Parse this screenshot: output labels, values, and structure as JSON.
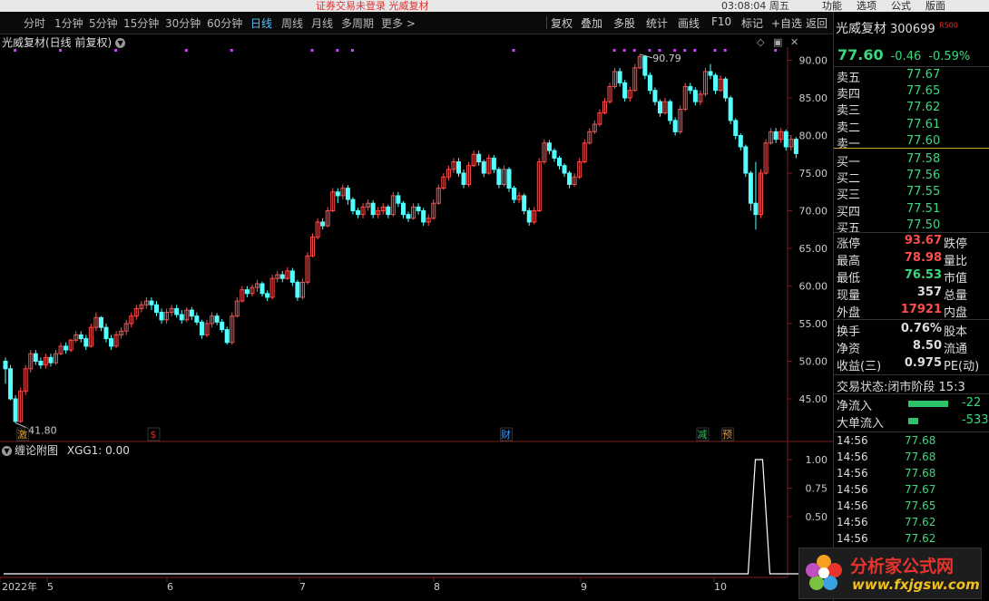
{
  "topbar": {
    "notice": "证券交易未登录  光威复材",
    "clock": "03:08:04 周五",
    "menus": [
      "功能",
      "选项",
      "公式",
      "版面"
    ]
  },
  "toolbar": {
    "periods": [
      "分时",
      "1分钟",
      "5分钟",
      "15分钟",
      "30分钟",
      "60分钟",
      "日线",
      "周线",
      "月线",
      "多周期",
      "更多 >"
    ],
    "active": "日线",
    "right_items": [
      "复权",
      "叠加",
      "多股",
      "统计",
      "画线",
      "F10",
      "标记",
      "+自选",
      "返回"
    ]
  },
  "chart": {
    "title": "光威复材(日线 前复权)",
    "y_ticks": [
      "90.00",
      "85.00",
      "80.00",
      "75.00",
      "70.00",
      "65.00",
      "60.00",
      "55.00",
      "50.00",
      "45.00"
    ],
    "max_label": "90.79",
    "min_label": "41.80",
    "x_labels": [
      "2022年",
      "5",
      "6",
      "7",
      "8",
      "9",
      "10"
    ],
    "markers": [
      {
        "text": "激",
        "color": "#e0a040"
      },
      {
        "text": "$",
        "color": "#e03030"
      },
      {
        "text": "财",
        "color": "#3aa0ff"
      },
      {
        "text": "减",
        "color": "#30c060"
      },
      {
        "text": "预",
        "color": "#e0a040"
      }
    ],
    "up_color": "#ff4d4d",
    "down_color": "#54ffff"
  },
  "chart_data": {
    "type": "candlestick",
    "ylim": [
      41.8,
      90.79
    ],
    "candles": [
      [
        50,
        49,
        50.5,
        47
      ],
      [
        49,
        45,
        49.5,
        44.8
      ],
      [
        45,
        42,
        45.5,
        41.8
      ],
      [
        42,
        46,
        46.5,
        41.8
      ],
      [
        46,
        49,
        49.5,
        45.5
      ],
      [
        49,
        51,
        51.5,
        48.5
      ],
      [
        51,
        50,
        51.5,
        49.5
      ],
      [
        50,
        49.5,
        50.5,
        49
      ],
      [
        49.5,
        50.5,
        51,
        49
      ],
      [
        50.5,
        49.8,
        51,
        49.3
      ],
      [
        49.8,
        51,
        51.5,
        49.5
      ],
      [
        51,
        52,
        52.5,
        50.8
      ],
      [
        52,
        51.5,
        52.5,
        51
      ],
      [
        51.5,
        52.8,
        53,
        51.2
      ],
      [
        52.8,
        53.5,
        54,
        52.5
      ],
      [
        53.5,
        53,
        54,
        52.5
      ],
      [
        53,
        52,
        53.5,
        51.5
      ],
      [
        52,
        54.5,
        55,
        51.8
      ],
      [
        54.5,
        55.8,
        56.5,
        54
      ],
      [
        55.8,
        54.5,
        56,
        54
      ],
      [
        54.5,
        53,
        55,
        52.5
      ],
      [
        53,
        52,
        53.5,
        51.5
      ],
      [
        52,
        53.5,
        54,
        51.8
      ],
      [
        53.5,
        54,
        54.5,
        53
      ],
      [
        54,
        55,
        55.5,
        53.5
      ],
      [
        55,
        56,
        56.5,
        54.5
      ],
      [
        56,
        57,
        57.5,
        55.5
      ],
      [
        57,
        57.5,
        58,
        56.5
      ],
      [
        57.5,
        58,
        58.5,
        57
      ],
      [
        58,
        57.5,
        58.5,
        56.8
      ],
      [
        57.5,
        56.5,
        58,
        56
      ],
      [
        56.5,
        55.5,
        57,
        55
      ],
      [
        55.5,
        56.5,
        57,
        55
      ],
      [
        56.5,
        57,
        57.5,
        56
      ],
      [
        57,
        56.2,
        57.5,
        55.8
      ],
      [
        56.2,
        55.5,
        56.8,
        55
      ],
      [
        55.5,
        56.8,
        57.2,
        55.2
      ],
      [
        56.8,
        56,
        57.2,
        55.5
      ],
      [
        56,
        55.2,
        56.5,
        54.8
      ],
      [
        55.2,
        53.5,
        55.5,
        53
      ],
      [
        53.5,
        55,
        55.5,
        53.2
      ],
      [
        55,
        56,
        56.5,
        54.5
      ],
      [
        56,
        55.2,
        56.4,
        54.8
      ],
      [
        55.2,
        54.2,
        55.6,
        53.8
      ],
      [
        54.2,
        52.5,
        54.6,
        52.2
      ],
      [
        52.5,
        56,
        56.5,
        52.2
      ],
      [
        56,
        58,
        58.5,
        55.8
      ],
      [
        58,
        59.5,
        60,
        57.8
      ],
      [
        59.5,
        59,
        60,
        58.5
      ],
      [
        59,
        59.8,
        60.2,
        58.6
      ],
      [
        59.8,
        60.3,
        60.8,
        59.2
      ],
      [
        60.3,
        59,
        60.6,
        58.6
      ],
      [
        59,
        58.5,
        59.4,
        58
      ],
      [
        58.5,
        61,
        61.5,
        58.2
      ],
      [
        61,
        61.5,
        62,
        60.5
      ],
      [
        61.5,
        61,
        62,
        60.5
      ],
      [
        61,
        62,
        62.5,
        60.8
      ],
      [
        62,
        60.5,
        62.4,
        60
      ],
      [
        60.5,
        58.5,
        60.8,
        58
      ],
      [
        58.5,
        60.5,
        61,
        58.2
      ],
      [
        60.5,
        64,
        64.5,
        60.2
      ],
      [
        64,
        66.5,
        67,
        63.8
      ],
      [
        66.5,
        68.5,
        69,
        66.2
      ],
      [
        68.5,
        68,
        69,
        67.5
      ],
      [
        68,
        70,
        70.5,
        67.8
      ],
      [
        70,
        72.5,
        73,
        69.8
      ],
      [
        72.5,
        72,
        73,
        71
      ],
      [
        72,
        73,
        73.5,
        71.5
      ],
      [
        73,
        71.5,
        73.4,
        70.8
      ],
      [
        71.5,
        70,
        71.8,
        69.5
      ],
      [
        70,
        69.5,
        70.4,
        69
      ],
      [
        69.5,
        70.5,
        71,
        69
      ],
      [
        70.5,
        71,
        71.5,
        70
      ],
      [
        71,
        69.5,
        71.4,
        69
      ],
      [
        69.5,
        70,
        70.5,
        69
      ],
      [
        70,
        70.5,
        71,
        69.5
      ],
      [
        70.5,
        69.5,
        70.8,
        69
      ],
      [
        69.5,
        72,
        72.5,
        69.2
      ],
      [
        72,
        71,
        72.5,
        70.5
      ],
      [
        71,
        69.5,
        71.3,
        69
      ],
      [
        69.5,
        69,
        69.9,
        68.5
      ],
      [
        69,
        70.5,
        71,
        68.8
      ],
      [
        70.5,
        70,
        71,
        69.5
      ],
      [
        70,
        68.5,
        70.4,
        68
      ],
      [
        68.5,
        69,
        69.5,
        68
      ],
      [
        69,
        71,
        71.5,
        68.8
      ],
      [
        71,
        73,
        73.5,
        70.8
      ],
      [
        73,
        74.5,
        75,
        72.8
      ],
      [
        74.5,
        75.5,
        76,
        74
      ],
      [
        75.5,
        76.5,
        77,
        75
      ],
      [
        76.5,
        75,
        77,
        74.5
      ],
      [
        75,
        73.5,
        75.5,
        73
      ],
      [
        73.5,
        76,
        76.5,
        73.2
      ],
      [
        76,
        77.5,
        78,
        75.8
      ],
      [
        77.5,
        76.5,
        78,
        76
      ],
      [
        76.5,
        75,
        76.8,
        74.5
      ],
      [
        75,
        77,
        77.5,
        74.8
      ],
      [
        77,
        75.5,
        77.4,
        75
      ],
      [
        75.5,
        73.5,
        75.8,
        73
      ],
      [
        73.5,
        75.5,
        76,
        73.2
      ],
      [
        75.5,
        73,
        75.8,
        72.5
      ],
      [
        73,
        71.5,
        73.3,
        71
      ],
      [
        71.5,
        72,
        72.5,
        71
      ],
      [
        72,
        70,
        72.3,
        69.5
      ],
      [
        70,
        68.5,
        70.4,
        68
      ],
      [
        68.5,
        70,
        70.5,
        68.2
      ],
      [
        70,
        76.5,
        77,
        69.8
      ],
      [
        76.5,
        79,
        79.5,
        76.2
      ],
      [
        79,
        78,
        79.4,
        77.5
      ],
      [
        78,
        77,
        78.3,
        76.5
      ],
      [
        77,
        76,
        77.3,
        75.5
      ],
      [
        76,
        75,
        76.3,
        74.5
      ],
      [
        75,
        73.5,
        75.3,
        73
      ],
      [
        73.5,
        74.5,
        75,
        73.2
      ],
      [
        74.5,
        76.5,
        77,
        74.2
      ],
      [
        76.5,
        79,
        79.5,
        76.3
      ],
      [
        79,
        80.5,
        81,
        78.8
      ],
      [
        80.5,
        81.5,
        82,
        80.2
      ],
      [
        81.5,
        83,
        83.5,
        81.2
      ],
      [
        83,
        84.5,
        85,
        82.8
      ],
      [
        84.5,
        86.5,
        87,
        84.2
      ],
      [
        86.5,
        88.5,
        89,
        86.2
      ],
      [
        88.5,
        87,
        89,
        86.5
      ],
      [
        87,
        85,
        87.4,
        84.5
      ],
      [
        85,
        86,
        86.5,
        84.5
      ],
      [
        86,
        89,
        89.5,
        85.8
      ],
      [
        89,
        90.5,
        90.79,
        88.8
      ],
      [
        90.5,
        88,
        90.7,
        87.5
      ],
      [
        88,
        86,
        88.4,
        85.5
      ],
      [
        86,
        84.5,
        86.4,
        84
      ],
      [
        84.5,
        83,
        84.8,
        82.5
      ],
      [
        83,
        84.5,
        85,
        82.8
      ],
      [
        84.5,
        82,
        84.8,
        81.5
      ],
      [
        82,
        80.5,
        82.4,
        80
      ],
      [
        80.5,
        83.5,
        84,
        80.2
      ],
      [
        83.5,
        86.5,
        87,
        83.2
      ],
      [
        86.5,
        86,
        87,
        85.5
      ],
      [
        86,
        84.5,
        86.4,
        84
      ],
      [
        84.5,
        85.5,
        86,
        84
      ],
      [
        85.5,
        88.5,
        89,
        85.2
      ],
      [
        88.5,
        88,
        89.5,
        87.5
      ],
      [
        88,
        86,
        88.3,
        85.5
      ],
      [
        86,
        87.5,
        88,
        85.8
      ],
      [
        87.5,
        85,
        87.8,
        84.5
      ],
      [
        85,
        82,
        85.3,
        81.5
      ],
      [
        82,
        80,
        82.3,
        79.5
      ],
      [
        80,
        78.5,
        80.3,
        78
      ],
      [
        78.5,
        75,
        78.8,
        74.5
      ],
      [
        75,
        71,
        75.3,
        70
      ],
      [
        71,
        69.5,
        76.5,
        67.5
      ],
      [
        69.5,
        75,
        75.5,
        69
      ],
      [
        75,
        79,
        79.5,
        74.8
      ],
      [
        79,
        80.5,
        81,
        78.8
      ],
      [
        80.5,
        79.5,
        81,
        79
      ],
      [
        79.5,
        80.5,
        81,
        79
      ],
      [
        80.5,
        78.5,
        80.8,
        78
      ],
      [
        78.5,
        79.5,
        80,
        78
      ],
      [
        79.5,
        77.6,
        79.8,
        77
      ]
    ],
    "indicator": {
      "name": "缠论附图",
      "label": "XGG1: 0.00",
      "y_ticks": [
        "1.00",
        "0.75",
        "0.50"
      ],
      "spike_index": 150,
      "spike_value": 1.0
    }
  },
  "right_panel": {
    "name": "光威复材",
    "code": "300699",
    "flag": "R",
    "flag2": "500",
    "price": "77.60",
    "change": "-0.46",
    "pct": "-0.59%",
    "asks": [
      {
        "label": "卖五",
        "price": "77.67"
      },
      {
        "label": "卖四",
        "price": "77.65"
      },
      {
        "label": "卖三",
        "price": "77.62"
      },
      {
        "label": "卖二",
        "price": "77.61"
      },
      {
        "label": "卖一",
        "price": "77.60"
      }
    ],
    "bids": [
      {
        "label": "买一",
        "price": "77.58"
      },
      {
        "label": "买二",
        "price": "77.56"
      },
      {
        "label": "买三",
        "price": "77.55"
      },
      {
        "label": "买四",
        "price": "77.51"
      },
      {
        "label": "买五",
        "price": "77.50"
      }
    ],
    "stats": [
      {
        "l1": "涨停",
        "v1": "93.67",
        "c": "#ff4d4d",
        "l2": "跌停"
      },
      {
        "l1": "最高",
        "v1": "78.98",
        "c": "#ff4d4d",
        "l2": "量比"
      },
      {
        "l1": "最低",
        "v1": "76.53",
        "c": "#3ad97e",
        "l2": "市值"
      },
      {
        "l1": "现量",
        "v1": "357",
        "c": "#dddddd",
        "l2": "总量"
      },
      {
        "l1": "外盘",
        "v1": "17921",
        "c": "#ff4d4d",
        "l2": "内盘"
      }
    ],
    "stats2": [
      {
        "l1": "换手",
        "v1": "0.76%",
        "c": "#dddddd",
        "l2": "股本"
      },
      {
        "l1": "净资",
        "v1": "8.50",
        "c": "#dddddd",
        "l2": "流通"
      },
      {
        "l1": "收益(三)",
        "v1": "0.975",
        "c": "#dddddd",
        "l2": "PE(动)"
      }
    ],
    "trade_status_label": "交易状态:",
    "trade_status": "闭市阶段 15:3",
    "flows": [
      {
        "label": "净流入",
        "value": "-22",
        "bar": 0.8
      },
      {
        "label": "大单流入",
        "value": "-533",
        "bar": 0.2
      }
    ],
    "ticks": [
      {
        "time": "14:56",
        "price": "77.68"
      },
      {
        "time": "14:56",
        "price": "77.68"
      },
      {
        "time": "14:56",
        "price": "77.68"
      },
      {
        "time": "14:56",
        "price": "77.67"
      },
      {
        "time": "14:56",
        "price": "77.65"
      },
      {
        "time": "14:56",
        "price": "77.62"
      },
      {
        "time": "14:56",
        "price": "77.62"
      }
    ]
  },
  "watermark": {
    "title": "分析家公式网",
    "url": "www.fxjgsw.com"
  }
}
